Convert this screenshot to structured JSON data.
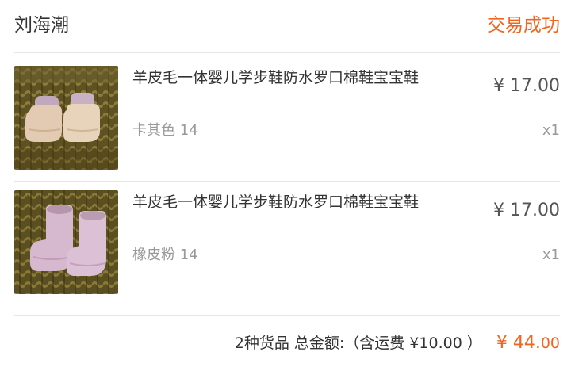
{
  "header": {
    "buyer_name": "刘海潮",
    "status": "交易成功"
  },
  "items": [
    {
      "title": "羊皮毛一体婴儿学步鞋防水罗口棉鞋宝宝鞋",
      "sku": "卡其色 14",
      "price": "¥ 17.00",
      "quantity": "x1",
      "image": "product-photo-beige-baby-boots"
    },
    {
      "title": "羊皮毛一体婴儿学步鞋防水罗口棉鞋宝宝鞋",
      "sku": "橡皮粉 14",
      "price": "¥ 17.00",
      "quantity": "x1",
      "image": "product-photo-pink-baby-boots"
    }
  ],
  "summary": {
    "text": "2种货品 总金额:（含运费 ¥10.00 ）",
    "total_main": "¥ 44.",
    "total_cents": "00"
  },
  "colors": {
    "accent": "#f0651f",
    "text": "#333333",
    "muted": "#999999",
    "divider": "#e6e6e6"
  }
}
